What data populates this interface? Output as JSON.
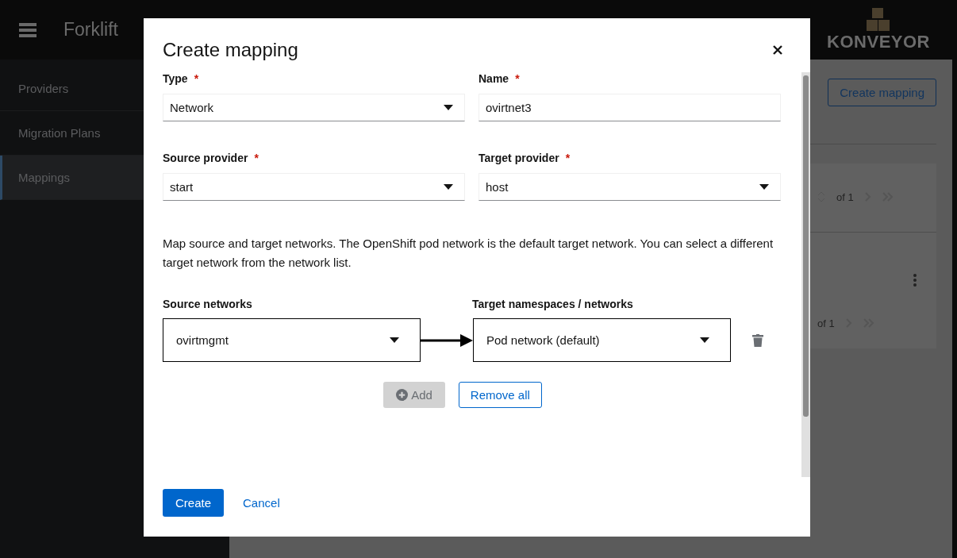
{
  "header": {
    "brand": "Forklift",
    "logo": "KONVEYOR"
  },
  "sidebar": {
    "items": [
      {
        "label": "Providers",
        "selected": false
      },
      {
        "label": "Migration Plans",
        "selected": false
      },
      {
        "label": "Mappings",
        "selected": true
      }
    ]
  },
  "background": {
    "create_button": "Create mapping",
    "pagination": [
      "of 1",
      "of 1"
    ]
  },
  "modal": {
    "title": "Create mapping",
    "fields": [
      {
        "label": "Type",
        "required_mark": "*",
        "kind": "select",
        "value": "Network"
      },
      {
        "label": "Name",
        "required_mark": "*",
        "kind": "text",
        "value": "ovirtnet3"
      },
      {
        "label": "Source provider",
        "required_mark": "*",
        "kind": "select",
        "value": "start"
      },
      {
        "label": "Target provider",
        "required_mark": "*",
        "kind": "select",
        "value": "host"
      }
    ],
    "description": "Map source and target networks. The OpenShift pod network is the default target network. You can select a different target network from the network list.",
    "mapping": {
      "source_label": "Source networks",
      "target_label": "Target namespaces / networks",
      "rows": [
        {
          "source": "ovirtmgmt",
          "target": "Pod network (default)"
        }
      ]
    },
    "add_button": {
      "label": "Add",
      "disabled": true
    },
    "remove_all_button": "Remove all",
    "footer": {
      "primary": "Create",
      "secondary": "Cancel"
    }
  }
}
